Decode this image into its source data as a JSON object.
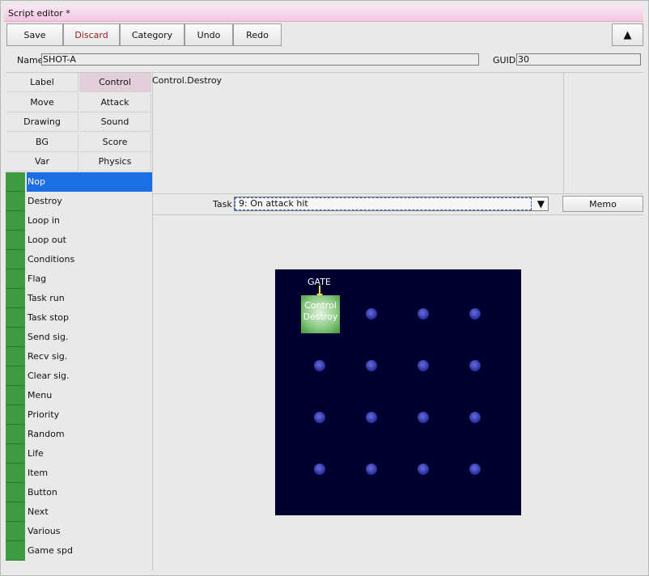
{
  "window": {
    "title": "Script editor *"
  },
  "toolbar": {
    "save": "Save",
    "discard": "Discard",
    "category": "Category",
    "undo": "Undo",
    "redo": "Redo",
    "collapse": "▲"
  },
  "props": {
    "name_label": "Name",
    "name_value": "SHOT-A",
    "guid_label": "GUID",
    "guid_value": "30"
  },
  "categories": [
    "Label",
    "Control",
    "Move",
    "Attack",
    "Drawing",
    "Sound",
    "BG",
    "Score",
    "Var",
    "Physics"
  ],
  "active_category": "Control",
  "commands": [
    "Nop",
    "Destroy",
    "Loop in",
    "Loop out",
    "Conditions",
    "Flag",
    "Task run",
    "Task stop",
    "Send sig.",
    "Recv sig.",
    "Clear sig.",
    "Menu",
    "Priority",
    "Random",
    "Life",
    "Item",
    "Button",
    "Next",
    "Various",
    "Game spd"
  ],
  "selected_command": "Nop",
  "description": "Control.Destroy",
  "task": {
    "label": "Task",
    "value": "9: On attack hit",
    "arrow": "▼",
    "memo": "Memo"
  },
  "graph": {
    "gate": "GATE",
    "node_line1": "Control",
    "node_line2": "Destroy"
  },
  "colors": {
    "accent_selected": "#1c6fe3",
    "command_swatch": "#3e9b42",
    "canvas": "#00002e",
    "title_bar": "#f3c6e2"
  }
}
